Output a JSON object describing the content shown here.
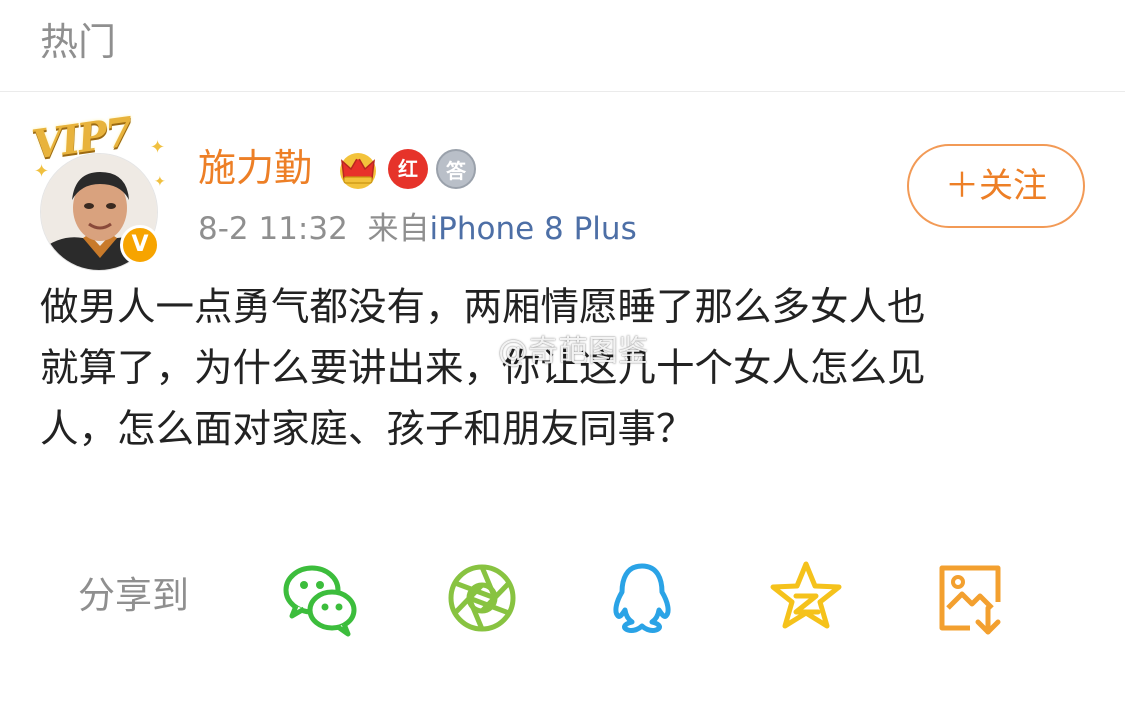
{
  "header": {
    "title": "热门"
  },
  "post": {
    "author": {
      "name": "施力勤",
      "vip_label": "VIP7",
      "badge_hong": "红",
      "badge_da": "答",
      "verified_mark": "V"
    },
    "meta": {
      "time": "8-2 11:32",
      "from_prefix": "来自",
      "source": "iPhone 8 Plus"
    },
    "follow_label": "＋关注",
    "content_lines": [
      "做男人一点勇气都没有，两厢情愿睡了那么多女人也",
      "就算了，为什么要讲出来，你让这几十个女人怎么见",
      "人，怎么面对家庭、孩子和朋友同事？"
    ],
    "watermark": "@奇葩图鉴"
  },
  "share": {
    "label": "分享到",
    "targets": [
      {
        "icon": "wechat-icon",
        "color": "#3cbd3c"
      },
      {
        "icon": "moments-icon",
        "color": "#88c341"
      },
      {
        "icon": "qq-icon",
        "color": "#2aa3e6"
      },
      {
        "icon": "qzone-icon",
        "color": "#f5c21b"
      },
      {
        "icon": "save-image-icon",
        "color": "#f3a02f"
      }
    ]
  },
  "colors": {
    "name": "#ed7f26",
    "source_link": "#4d6fa6",
    "muted": "#8f8f8f"
  }
}
